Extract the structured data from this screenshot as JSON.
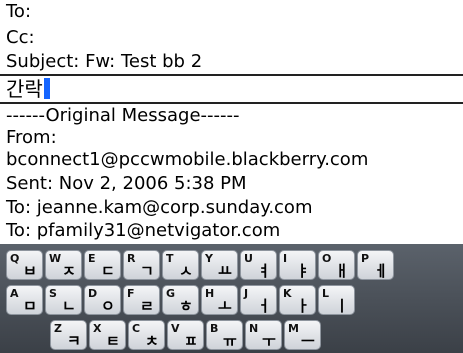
{
  "header": {
    "to_label": "To:",
    "cc_label": "Cc:",
    "subject_line": "Subject: Fw: Test bb 2"
  },
  "compose": {
    "typed_text": "간락"
  },
  "original": {
    "separator": "------Original Message------",
    "from_label": "From:",
    "from_value": "bconnect1@pccwmobile.blackberry.com",
    "sent_line": "Sent: Nov 2, 2006 5:38 PM",
    "to_line_1": "To: jeanne.kam@corp.sunday.com",
    "to_line_2": "To: pfamily31@netvigator.com"
  },
  "keyboard": {
    "row1": [
      {
        "en": "Q",
        "ko": "ㅂ"
      },
      {
        "en": "W",
        "ko": "ㅈ"
      },
      {
        "en": "E",
        "ko": "ㄷ"
      },
      {
        "en": "R",
        "ko": "ㄱ"
      },
      {
        "en": "T",
        "ko": "ㅅ"
      },
      {
        "en": "Y",
        "ko": "ㅛ"
      },
      {
        "en": "U",
        "ko": "ㅕ"
      },
      {
        "en": "I",
        "ko": "ㅑ"
      },
      {
        "en": "O",
        "ko": "ㅐ"
      },
      {
        "en": "P",
        "ko": "ㅔ"
      }
    ],
    "row2": [
      {
        "en": "A",
        "ko": "ㅁ"
      },
      {
        "en": "S",
        "ko": "ㄴ"
      },
      {
        "en": "D",
        "ko": "ㅇ"
      },
      {
        "en": "F",
        "ko": "ㄹ"
      },
      {
        "en": "G",
        "ko": "ㅎ"
      },
      {
        "en": "H",
        "ko": "ㅗ"
      },
      {
        "en": "J",
        "ko": "ㅓ"
      },
      {
        "en": "K",
        "ko": "ㅏ"
      },
      {
        "en": "L",
        "ko": "ㅣ"
      }
    ],
    "row3": [
      {
        "en": "Z",
        "ko": "ㅋ"
      },
      {
        "en": "X",
        "ko": "ㅌ"
      },
      {
        "en": "C",
        "ko": "ㅊ"
      },
      {
        "en": "V",
        "ko": "ㅍ"
      },
      {
        "en": "B",
        "ko": "ㅠ"
      },
      {
        "en": "N",
        "ko": "ㅜ"
      },
      {
        "en": "M",
        "ko": "ㅡ"
      }
    ]
  }
}
